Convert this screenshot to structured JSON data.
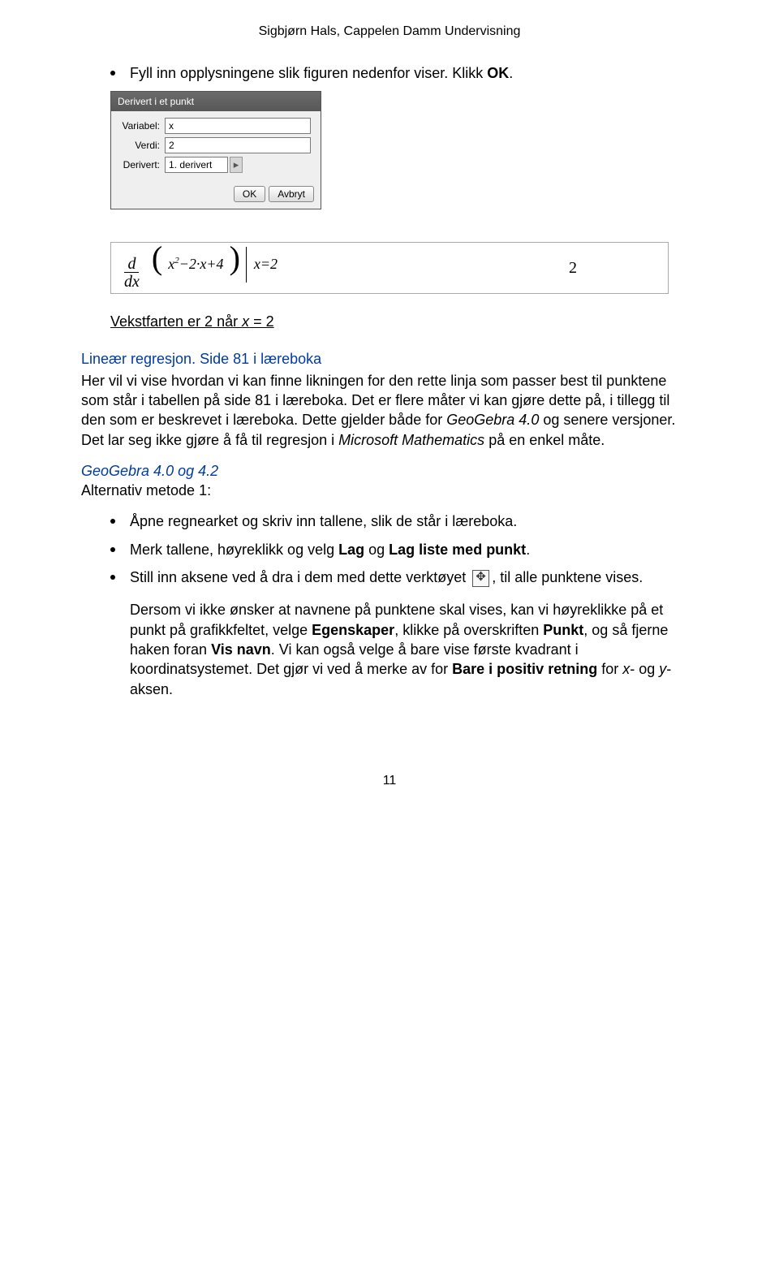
{
  "header": "Sigbjørn Hals, Cappelen Damm Undervisning",
  "bullet1": {
    "pre": "Fyll inn opplysningene slik figuren nedenfor viser. Klikk ",
    "bold": "OK",
    "post": "."
  },
  "dialog": {
    "title": "Derivert i et punkt",
    "label_variabel": "Variabel:",
    "val_variabel": "x",
    "label_verdi": "Verdi:",
    "val_verdi": "2",
    "label_derivert": "Derivert:",
    "val_derivert": "1. derivert",
    "btn_ok": "OK",
    "btn_cancel": "Avbryt"
  },
  "mathbox": {
    "d": "d",
    "dx": "dx",
    "inner": "x",
    "sq": "2",
    "mid": "−2·x+4",
    "cond": "|x=2",
    "result": "2"
  },
  "vekst_line": {
    "pre": "Vekstfarten er 2 når ",
    "xeq": "x",
    "post": " = 2"
  },
  "heading_linear": "Lineær regresjon. ",
  "heading_side": "Side 81 i læreboka",
  "para1": {
    "a": "Her vil vi vise hvordan vi kan finne likningen for den rette linja som passer best til punktene som står i tabellen på side 81 i læreboka. Det er flere måter vi kan gjøre dette på, i tillegg til den som er beskrevet i læreboka. Dette gjelder både for ",
    "geo": "GeoGebra 4.0",
    "b": " og senere versjoner. Det lar seg ikke gjøre å få til regresjon i ",
    "ms": "Microsoft Mathematics",
    "c": " på en enkel måte."
  },
  "geo42": "GeoGebra 4.0 og 4.2",
  "alt1_label": "Alternativ metode 1:",
  "bullets_alt": {
    "b1": "Åpne regnearket og skriv inn tallene, slik de står i læreboka.",
    "b2_pre": "Merk tallene, høyreklikk og velg ",
    "b2_b1": "Lag",
    "b2_mid": " og ",
    "b2_b2": "Lag liste med punkt",
    "b2_post": ".",
    "b3_pre": "Still inn aksene ved å dra i dem med dette verktøyet ",
    "b3_post": ", til alle punktene vises."
  },
  "para_dersom": {
    "a": "Dersom vi ikke ønsker at navnene på punktene skal vises, kan vi høyreklikke på et punkt på grafikkfeltet, velge ",
    "b1": "Egenskaper",
    "b": ", klikke på overskriften ",
    "b2": "Punkt",
    "c": ", og så fjerne haken foran ",
    "b3": "Vis navn",
    "d": ". Vi kan også velge å bare vise første kvadrant i koordinatsystemet. Det gjør vi ved å merke av for ",
    "b4": "Bare i positiv retning",
    "e": " for ",
    "xi": "x",
    "f": "- og ",
    "yi": "y",
    "g": "-aksen."
  },
  "pagenum": "11"
}
